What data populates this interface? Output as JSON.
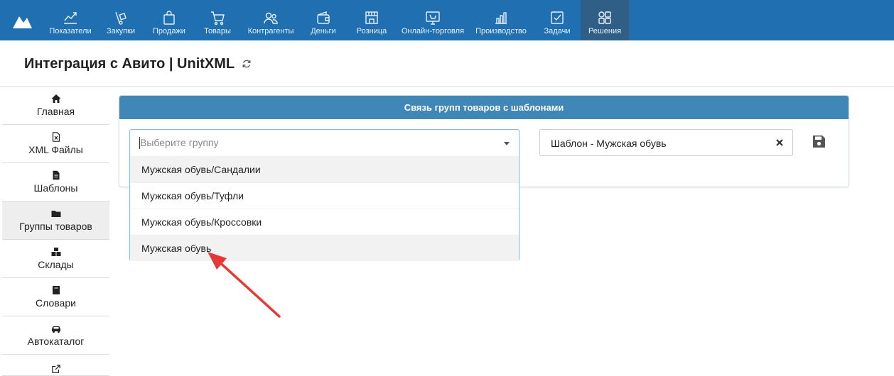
{
  "nav": {
    "items": [
      {
        "label": "Показатели",
        "icon": "chart-line-icon"
      },
      {
        "label": "Закупки",
        "icon": "cart-dolly-icon"
      },
      {
        "label": "Продажи",
        "icon": "shopping-bag-icon"
      },
      {
        "label": "Товары",
        "icon": "shopping-cart-icon"
      },
      {
        "label": "Контрагенты",
        "icon": "users-icon"
      },
      {
        "label": "Деньги",
        "icon": "wallet-icon"
      },
      {
        "label": "Розница",
        "icon": "store-icon"
      },
      {
        "label": "Онлайн-торговля",
        "icon": "online-store-icon"
      },
      {
        "label": "Производство",
        "icon": "bar-chart-icon"
      },
      {
        "label": "Задачи",
        "icon": "checkbox-icon"
      },
      {
        "label": "Решения",
        "icon": "apps-icon"
      }
    ],
    "active": "Решения"
  },
  "header": {
    "title": "Интеграция с Авито | UnitXML"
  },
  "sidebar": {
    "items": [
      {
        "label": "Главная",
        "icon": "home-icon"
      },
      {
        "label": "XML Файлы",
        "icon": "file-xml-icon"
      },
      {
        "label": "Шаблоны",
        "icon": "file-icon"
      },
      {
        "label": "Группы товаров",
        "icon": "folder-icon"
      },
      {
        "label": "Склады",
        "icon": "boxes-icon"
      },
      {
        "label": "Словари",
        "icon": "book-icon"
      },
      {
        "label": "Автокаталог",
        "icon": "car-icon"
      }
    ],
    "active": "Группы товаров"
  },
  "panel": {
    "title": "Связь групп товаров с шаблонами",
    "group_select": {
      "placeholder": "Выберите группу",
      "options": [
        "Мужская обувь/Сандалии",
        "Мужская обувь/Туфли",
        "Мужская обувь/Кроссовки",
        "Мужская обувь"
      ],
      "highlighted": "Мужская обувь"
    },
    "template_select": {
      "value": "Шаблон - Мужская обувь"
    }
  },
  "colors": {
    "nav_bg": "#1f6fb1",
    "nav_active": "#2f5f87",
    "panel_head": "#3f87b6",
    "annotation_arrow": "#e53935"
  }
}
